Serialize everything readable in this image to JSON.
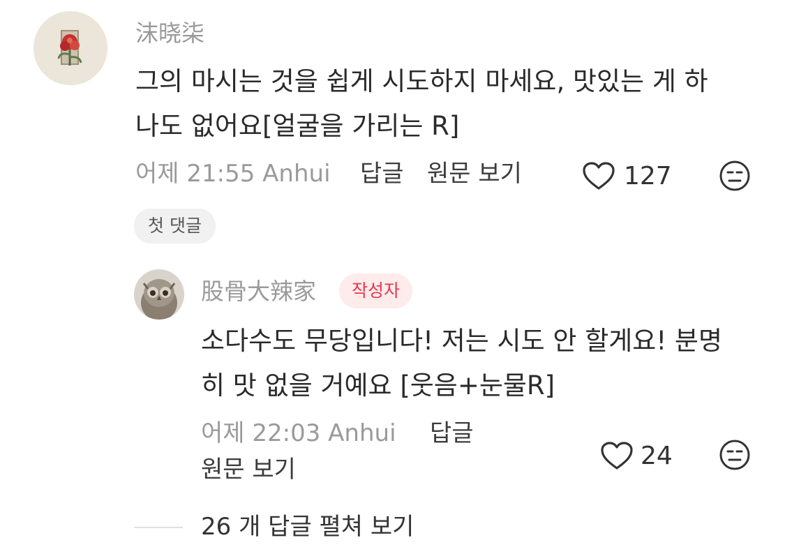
{
  "comment": {
    "username": "沫晓柒",
    "text_line1": "그의 마시는 것을 쉽게 시도하지 마세요, 맛있는 게 하",
    "text_line2": "나도 없어요[얼굴을 가리는 R]",
    "time_location": "어제 21:55 Anhui",
    "reply_label": "답글",
    "view_original_label": "원문 보기",
    "like_count": "127",
    "chip_label": "첫 댓글"
  },
  "reply": {
    "username": "股骨大辣家",
    "badge": "작성자",
    "text_line1": "소다수도 무당입니다! 저는 시도 안 할게요! 분명",
    "text_line2": "히 맛 없을 거예요 [웃음+눈물R]",
    "time_location": "어제 22:03 Anhui",
    "reply_label": "답글",
    "view_original_label": "원문 보기",
    "like_count": "24"
  },
  "expand_replies_label": "26 개 답글 펼쳐 보기",
  "colors": {
    "badge_text": "#e8364f",
    "badge_bg": "#fdeceb",
    "muted_text": "#9a9a9a"
  },
  "icons": [
    "flower-avatar",
    "owl-avatar",
    "heart-icon",
    "meh-face-icon"
  ]
}
